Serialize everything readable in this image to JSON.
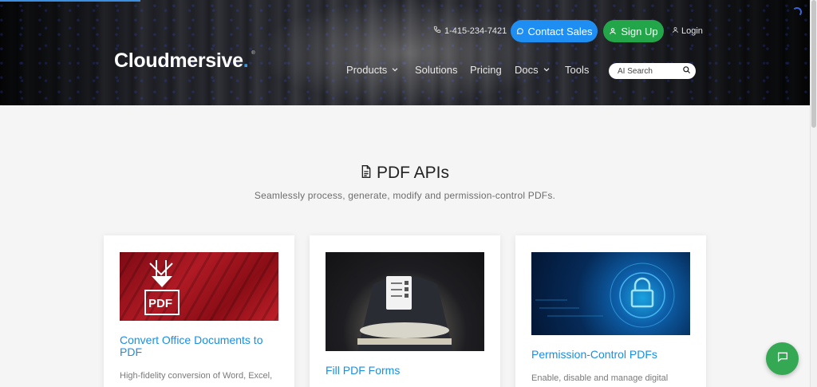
{
  "header": {
    "logo_text": "Cloudmersive",
    "logo_dot": ".",
    "logo_reg": "®",
    "phone": "1-415-234-7421",
    "contact_sales": "Contact Sales",
    "sign_up": "Sign Up",
    "login": "Login",
    "nav": {
      "products": "Products",
      "solutions": "Solutions",
      "pricing": "Pricing",
      "docs": "Docs",
      "tools": "Tools"
    },
    "search_placeholder": "AI Search"
  },
  "main": {
    "title": "PDF APIs",
    "subtitle": "Seamlessly process, generate, modify and permission-control PDFs.",
    "cards": [
      {
        "title": "Convert Office Documents to PDF",
        "description": "High-fidelity conversion of Word, Excel,",
        "image_label": "PDF"
      },
      {
        "title": "Fill PDF Forms",
        "description": ""
      },
      {
        "title": "Permission-Control PDFs",
        "description": "Enable, disable and manage digital"
      }
    ]
  },
  "colors": {
    "accent_blue": "#1f8ef2",
    "signup_green": "#23a64a",
    "link_blue": "#1a8fe0",
    "chat_green": "#34a853"
  }
}
